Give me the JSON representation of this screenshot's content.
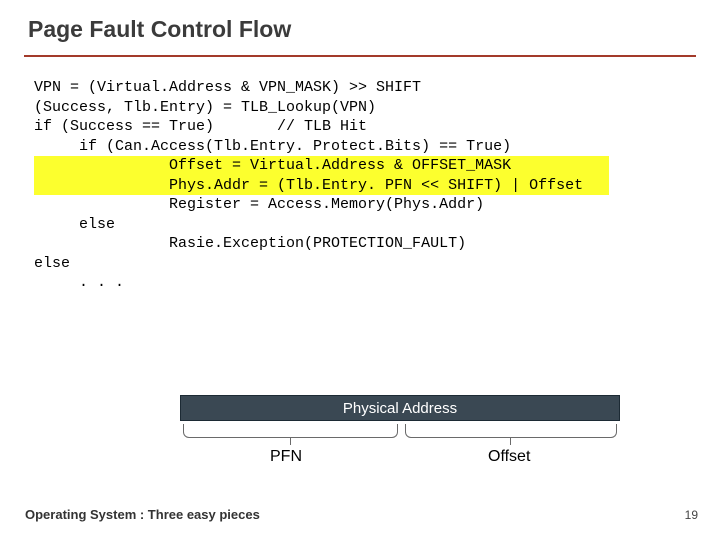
{
  "title": "Page Fault Control Flow",
  "code": {
    "l1": "VPN = (Virtual.Address & VPN_MASK) >> SHIFT",
    "l2": "(Success, Tlb.Entry) = TLB_Lookup(VPN)",
    "l3": "if (Success == True)       // TLB Hit",
    "l4": "     if (Can.Access(Tlb.Entry. Protect.Bits) == True)",
    "l5a": "               Offset = Virtual.Address & OFFSET_MASK",
    "l5b": "               Phys.Addr = (Tlb.Entry. PFN << SHIFT) | Offset",
    "l6": "               Register = Access.Memory(Phys.Addr)",
    "l7": "     else",
    "l8": "               Rasie.Exception(PROTECTION_FAULT)",
    "l9": "else",
    "l10": "     . . ."
  },
  "diagram": {
    "box": "Physical Address",
    "left": "PFN",
    "right": "Offset"
  },
  "footer": "Operating System : Three easy pieces",
  "page": "19"
}
